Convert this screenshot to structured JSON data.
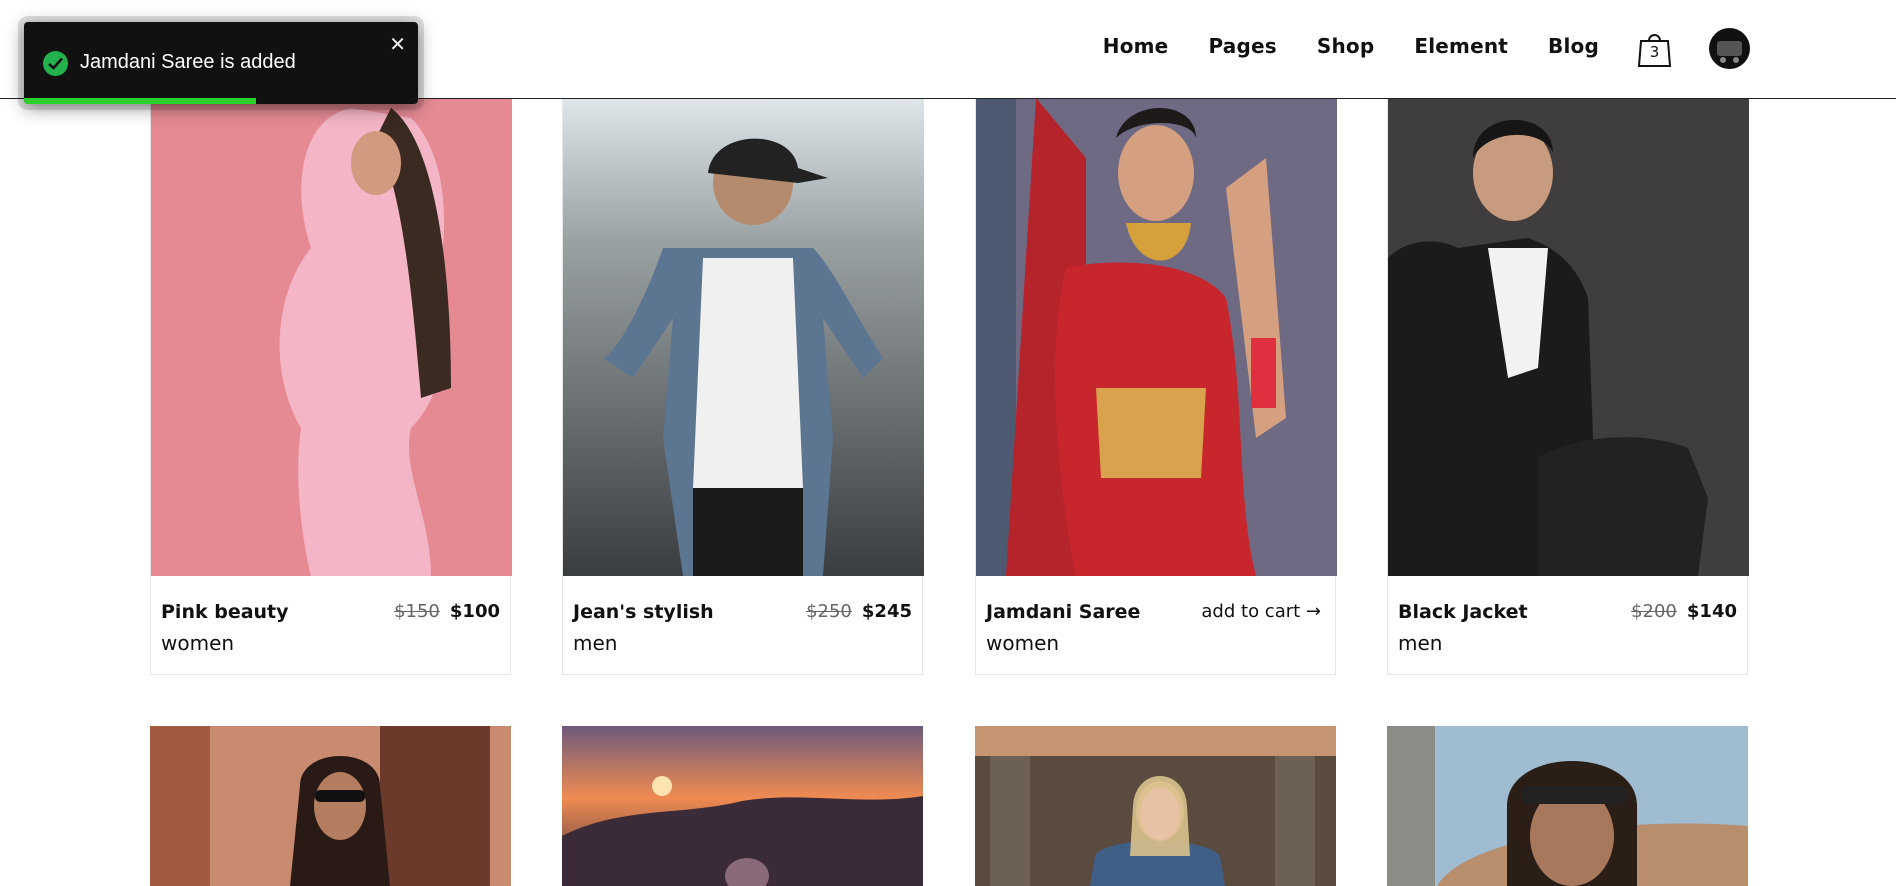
{
  "nav": {
    "items": [
      "Home",
      "Pages",
      "Shop",
      "Element",
      "Blog"
    ],
    "cart_count": "3"
  },
  "toast": {
    "message": "Jamdani Saree is added",
    "close_glyph": "✕",
    "progress_fraction": 0.59,
    "colors": {
      "background": "#111111",
      "check": "#22b14c",
      "progress": "#2bd12b"
    }
  },
  "products": [
    {
      "title": "Pink beauty",
      "category": "women",
      "old_price": "$150",
      "price": "$100"
    },
    {
      "title": "Jean's stylish",
      "category": "men",
      "old_price": "$250",
      "price": "$245"
    },
    {
      "title": "Jamdani Saree",
      "category": "women",
      "action": "add to cart →"
    },
    {
      "title": "Black Jacket",
      "category": "men",
      "old_price": "$200",
      "price": "$140"
    }
  ],
  "icons": {
    "cart": "shopping-bag-icon",
    "avatar": "cart-avatar-icon",
    "check": "check-circle-icon",
    "close": "close-icon"
  }
}
